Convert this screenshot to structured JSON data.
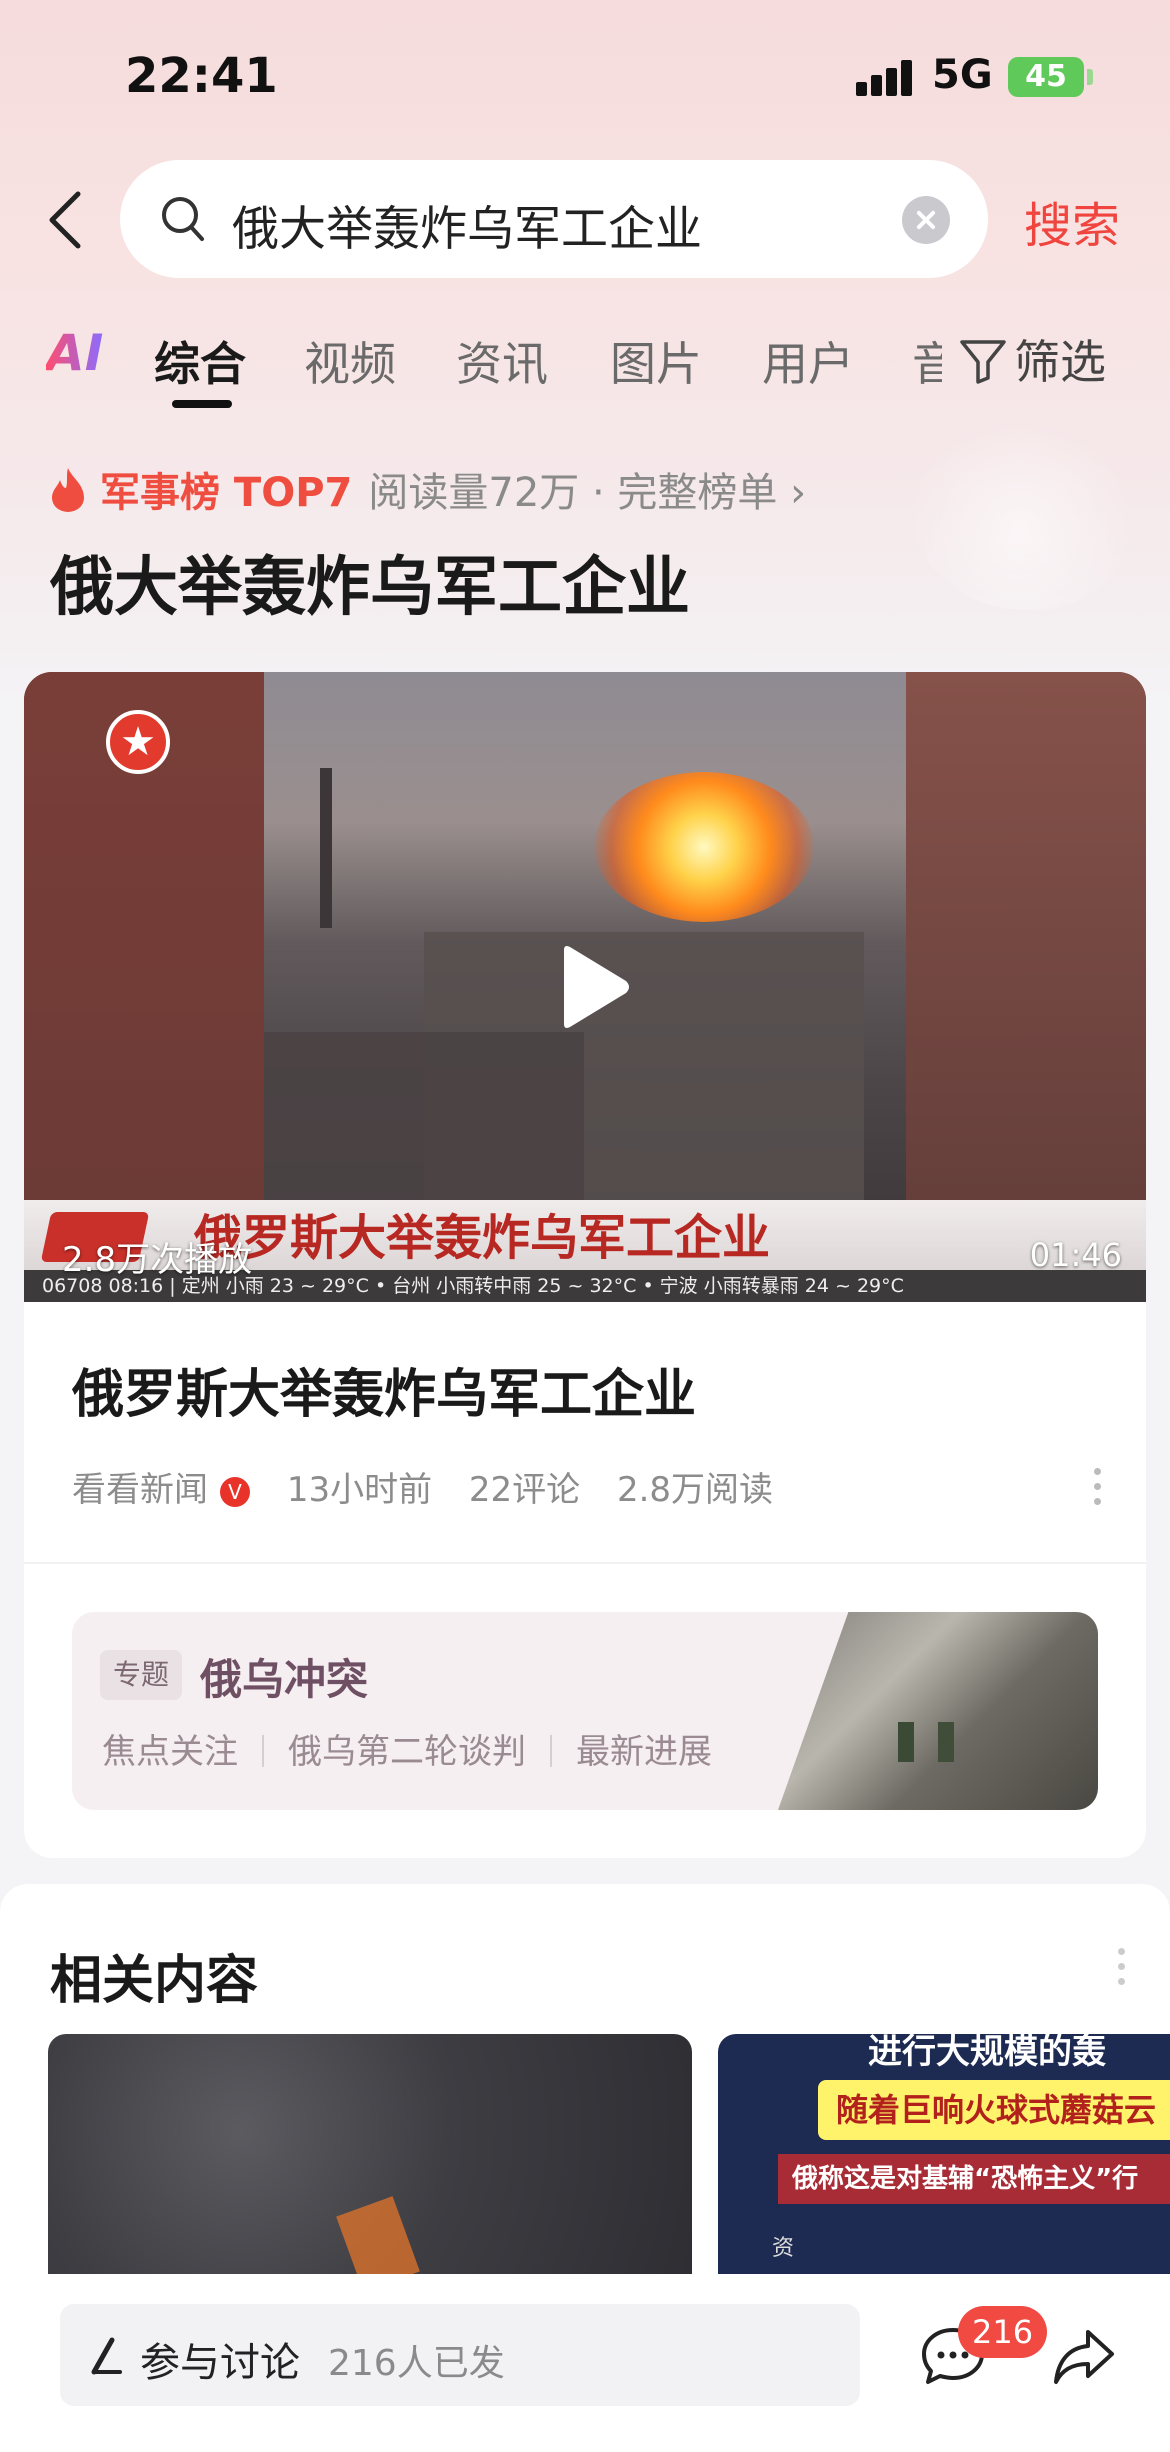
{
  "status_bar": {
    "time": "22:41",
    "network": "5G",
    "battery": "45"
  },
  "search": {
    "query": "俄大举轰炸乌军工企业",
    "submit_label": "搜索"
  },
  "tabs": {
    "ai": "AI",
    "items": [
      "综合",
      "视频",
      "资讯",
      "图片",
      "用户",
      "音"
    ],
    "active": "综合",
    "filter": "筛选"
  },
  "rank": {
    "name": "军事榜 TOP7",
    "meta": "阅读量72万 · 完整榜单 ›"
  },
  "headline": "俄大举轰炸乌军工企业",
  "video": {
    "logo": "★",
    "ticker_title": "俄罗斯大举轰炸乌军工企业",
    "ticker_bottom": "06708 08:16 | 定州 小雨 23 ~ 29°C     • 台州 小雨转中雨 25 ~ 32°C     • 宁波 小雨转暴雨 24 ~ 29°C",
    "plays": "2.8万次播放",
    "duration": "01:46"
  },
  "article": {
    "title": "俄罗斯大举轰炸乌军工企业",
    "source": "看看新闻",
    "verified": "V",
    "time": "13小时前",
    "comments": "22评论",
    "reads": "2.8万阅读"
  },
  "topic": {
    "tag": "专题",
    "name": "俄乌冲突",
    "links": [
      "焦点关注",
      "俄乌第二轮谈判",
      "最新进展"
    ]
  },
  "related": {
    "title": "相关内容",
    "card2": {
      "line1": "进行大规模的轰",
      "line2": "随着巨响火球式蘑菇云",
      "line3": "俄称这是对基辅“恐怖主义”行",
      "small": "资"
    }
  },
  "bottom": {
    "discuss_label": "参与讨论",
    "discuss_count": "216人已发",
    "comment_badge": "216"
  },
  "colors": {
    "accent": "#f0453e",
    "rank": "#ef4d3f",
    "topic": "#6f4f63"
  }
}
